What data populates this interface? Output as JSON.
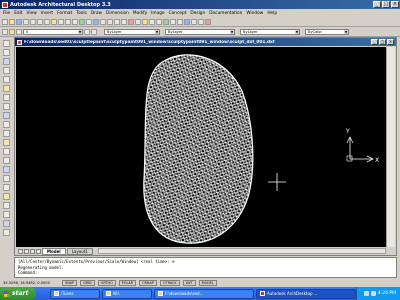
{
  "window": {
    "title": "Autodesk Architectural Desktop 3.3"
  },
  "menu": [
    "File",
    "Edit",
    "View",
    "Insert",
    "Format",
    "Tools",
    "Draw",
    "Dimension",
    "Modify",
    "Image",
    "Concept",
    "Design",
    "Documentation",
    "Window",
    "Help"
  ],
  "toolbar": {
    "layer_value": "0",
    "color_value": "ByLayer",
    "linetype_value": "ByLayer",
    "lineweight_value": "ByLayer",
    "plotstyle_value": "ByColor"
  },
  "drawing": {
    "title": "F:\\downloads\\sed01\\sculptlepaint\\sculptypaint091_window\\sculptypaint091_window\\sculpt_dxf_001.dxf"
  },
  "ucs": {
    "x_label": "X",
    "y_label": "Y"
  },
  "tabs": [
    {
      "label": "Model"
    },
    {
      "label": "Layout1"
    }
  ],
  "command": {
    "line1": "[All/Center/Dynamic/Extents/Previous/Scale/Window] <real time>: e",
    "line2": "Regenerating model.",
    "prompt": "Command:"
  },
  "status": {
    "coords": "39.5296, 16.9482, 0.0000",
    "buttons": [
      "SNAP",
      "GRID",
      "ORTHO",
      "POLAR",
      "OSNAP",
      "OTRACK",
      "LWT",
      "MODEL"
    ]
  },
  "taskbar": {
    "start_label": "start",
    "tasks": [
      {
        "label": "iTunes"
      },
      {
        "label": "W:\\"
      },
      {
        "label": "F:\\downloads\\sed..."
      },
      {
        "label": "Autodesk ArchDesktop ..."
      }
    ],
    "clock": "4:24 PM"
  },
  "colors": {
    "title_bar": "#0a246a",
    "canvas": "#000000",
    "wireframe": "#ffffff",
    "taskbar": "#245edb",
    "start_button": "#3c983c"
  }
}
